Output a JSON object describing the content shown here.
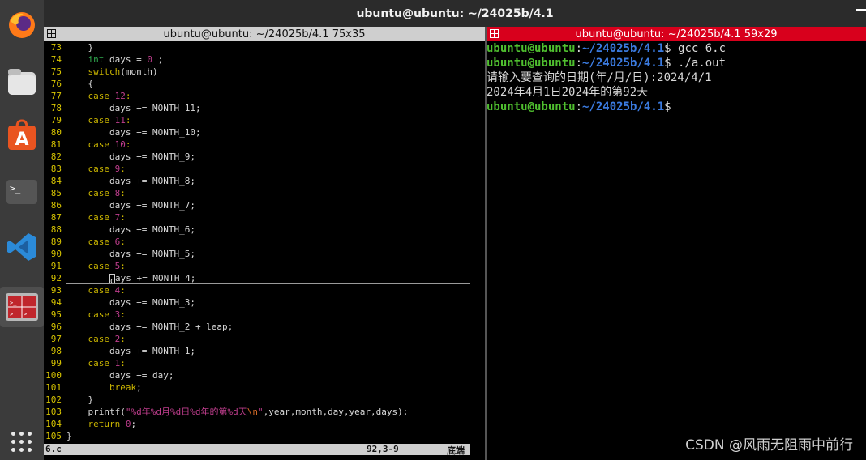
{
  "window": {
    "title": "ubuntu@ubuntu: ~/24025b/4.1"
  },
  "panes": {
    "left_title": "ubuntu@ubuntu: ~/24025b/4.1 75x35",
    "right_title": "ubuntu@ubuntu: ~/24025b/4.1 59x29"
  },
  "dock": {
    "items": [
      "firefox-icon",
      "files-icon",
      "software-icon",
      "terminal-icon",
      "vscode-icon",
      "terminal-split-icon",
      "show-apps-icon"
    ]
  },
  "editor": {
    "lines": [
      {
        "n": "73",
        "parts": [
          {
            "t": "    }",
            "c": "tx"
          }
        ]
      },
      {
        "n": "74",
        "parts": [
          {
            "t": "    ",
            "c": "tx"
          },
          {
            "t": "int",
            "c": "ty"
          },
          {
            "t": " days = ",
            "c": "tx"
          },
          {
            "t": "0",
            "c": "st"
          },
          {
            "t": " ;",
            "c": "tx"
          }
        ]
      },
      {
        "n": "75",
        "parts": [
          {
            "t": "    ",
            "c": "tx"
          },
          {
            "t": "switch",
            "c": "kw"
          },
          {
            "t": "(month)",
            "c": "tx"
          }
        ]
      },
      {
        "n": "76",
        "parts": [
          {
            "t": "    {",
            "c": "tx"
          }
        ]
      },
      {
        "n": "77",
        "parts": [
          {
            "t": "    ",
            "c": "tx"
          },
          {
            "t": "case",
            "c": "kw"
          },
          {
            "t": " ",
            "c": "tx"
          },
          {
            "t": "12",
            "c": "st"
          },
          {
            "t": ":",
            "c": "kw"
          }
        ]
      },
      {
        "n": "78",
        "parts": [
          {
            "t": "        days += MONTH_11;",
            "c": "tx"
          }
        ]
      },
      {
        "n": "79",
        "parts": [
          {
            "t": "    ",
            "c": "tx"
          },
          {
            "t": "case",
            "c": "kw"
          },
          {
            "t": " ",
            "c": "tx"
          },
          {
            "t": "11",
            "c": "st"
          },
          {
            "t": ":",
            "c": "kw"
          }
        ]
      },
      {
        "n": "80",
        "parts": [
          {
            "t": "        days += MONTH_10;",
            "c": "tx"
          }
        ]
      },
      {
        "n": "81",
        "parts": [
          {
            "t": "    ",
            "c": "tx"
          },
          {
            "t": "case",
            "c": "kw"
          },
          {
            "t": " ",
            "c": "tx"
          },
          {
            "t": "10",
            "c": "st"
          },
          {
            "t": ":",
            "c": "kw"
          }
        ]
      },
      {
        "n": "82",
        "parts": [
          {
            "t": "        days += MONTH_9;",
            "c": "tx"
          }
        ]
      },
      {
        "n": "83",
        "parts": [
          {
            "t": "    ",
            "c": "tx"
          },
          {
            "t": "case",
            "c": "kw"
          },
          {
            "t": " ",
            "c": "tx"
          },
          {
            "t": "9",
            "c": "st"
          },
          {
            "t": ":",
            "c": "kw"
          }
        ]
      },
      {
        "n": "84",
        "parts": [
          {
            "t": "        days += MONTH_8;",
            "c": "tx"
          }
        ]
      },
      {
        "n": "85",
        "parts": [
          {
            "t": "    ",
            "c": "tx"
          },
          {
            "t": "case",
            "c": "kw"
          },
          {
            "t": " ",
            "c": "tx"
          },
          {
            "t": "8",
            "c": "st"
          },
          {
            "t": ":",
            "c": "kw"
          }
        ]
      },
      {
        "n": "86",
        "parts": [
          {
            "t": "        days += MONTH_7;",
            "c": "tx"
          }
        ]
      },
      {
        "n": "87",
        "parts": [
          {
            "t": "    ",
            "c": "tx"
          },
          {
            "t": "case",
            "c": "kw"
          },
          {
            "t": " ",
            "c": "tx"
          },
          {
            "t": "7",
            "c": "st"
          },
          {
            "t": ":",
            "c": "kw"
          }
        ]
      },
      {
        "n": "88",
        "parts": [
          {
            "t": "        days += MONTH_6;",
            "c": "tx"
          }
        ]
      },
      {
        "n": "89",
        "parts": [
          {
            "t": "    ",
            "c": "tx"
          },
          {
            "t": "case",
            "c": "kw"
          },
          {
            "t": " ",
            "c": "tx"
          },
          {
            "t": "6",
            "c": "st"
          },
          {
            "t": ":",
            "c": "kw"
          }
        ]
      },
      {
        "n": "90",
        "parts": [
          {
            "t": "        days += MONTH_5;",
            "c": "tx"
          }
        ]
      },
      {
        "n": "91",
        "parts": [
          {
            "t": "    ",
            "c": "tx"
          },
          {
            "t": "case",
            "c": "kw"
          },
          {
            "t": " ",
            "c": "tx"
          },
          {
            "t": "5",
            "c": "st"
          },
          {
            "t": ":",
            "c": "kw"
          }
        ]
      },
      {
        "n": "92",
        "cursor": true,
        "pre": "        ",
        "cur": "d",
        "post": "ays += MONTH_4;"
      },
      {
        "n": "93",
        "parts": [
          {
            "t": "    ",
            "c": "tx"
          },
          {
            "t": "case",
            "c": "kw"
          },
          {
            "t": " ",
            "c": "tx"
          },
          {
            "t": "4",
            "c": "st"
          },
          {
            "t": ":",
            "c": "kw"
          }
        ]
      },
      {
        "n": "94",
        "parts": [
          {
            "t": "        days += MONTH_3;",
            "c": "tx"
          }
        ]
      },
      {
        "n": "95",
        "parts": [
          {
            "t": "    ",
            "c": "tx"
          },
          {
            "t": "case",
            "c": "kw"
          },
          {
            "t": " ",
            "c": "tx"
          },
          {
            "t": "3",
            "c": "st"
          },
          {
            "t": ":",
            "c": "kw"
          }
        ]
      },
      {
        "n": "96",
        "parts": [
          {
            "t": "        days += MONTH_2 + leap;",
            "c": "tx"
          }
        ]
      },
      {
        "n": "97",
        "parts": [
          {
            "t": "    ",
            "c": "tx"
          },
          {
            "t": "case",
            "c": "kw"
          },
          {
            "t": " ",
            "c": "tx"
          },
          {
            "t": "2",
            "c": "st"
          },
          {
            "t": ":",
            "c": "kw"
          }
        ]
      },
      {
        "n": "98",
        "parts": [
          {
            "t": "        days += MONTH_1;",
            "c": "tx"
          }
        ]
      },
      {
        "n": "99",
        "parts": [
          {
            "t": "    ",
            "c": "tx"
          },
          {
            "t": "case",
            "c": "kw"
          },
          {
            "t": " ",
            "c": "tx"
          },
          {
            "t": "1",
            "c": "st"
          },
          {
            "t": ":",
            "c": "kw"
          }
        ]
      },
      {
        "n": "100",
        "parts": [
          {
            "t": "        days += day;",
            "c": "tx"
          }
        ]
      },
      {
        "n": "101",
        "parts": [
          {
            "t": "        ",
            "c": "tx"
          },
          {
            "t": "break",
            "c": "kw"
          },
          {
            "t": ";",
            "c": "tx"
          }
        ]
      },
      {
        "n": "102",
        "parts": [
          {
            "t": "    }",
            "c": "tx"
          }
        ]
      },
      {
        "n": "103",
        "parts": [
          {
            "t": "    printf(",
            "c": "tx"
          },
          {
            "t": "\"%d年%d月%d日%d年的第%d天",
            "c": "st"
          },
          {
            "t": "\\n",
            "c": "esc"
          },
          {
            "t": "\"",
            "c": "st"
          },
          {
            "t": ",year,month,day,year,days);",
            "c": "tx"
          }
        ]
      },
      {
        "n": "104",
        "parts": [
          {
            "t": "    ",
            "c": "tx"
          },
          {
            "t": "return",
            "c": "kw"
          },
          {
            "t": " ",
            "c": "tx"
          },
          {
            "t": "0",
            "c": "st"
          },
          {
            "t": ";",
            "c": "tx"
          }
        ]
      },
      {
        "n": "105",
        "parts": [
          {
            "t": "}",
            "c": "tx"
          }
        ]
      }
    ],
    "status": {
      "file": "6.c",
      "position": "92,3-9",
      "scroll": "底端"
    }
  },
  "terminal": {
    "lines": [
      {
        "user": "ubuntu@ubuntu",
        "path": "~/24025b/4.1",
        "cmd": " gcc 6.c"
      },
      {
        "user": "ubuntu@ubuntu",
        "path": "~/24025b/4.1",
        "cmd": " ./a.out"
      },
      {
        "out": "请输入要查询的日期(年/月/日):2024/4/1"
      },
      {
        "out": "2024年4月1日2024年的第92天"
      },
      {
        "user": "ubuntu@ubuntu",
        "path": "~/24025b/4.1",
        "cmd": ""
      }
    ]
  },
  "watermark": "CSDN @风雨无阻雨中前行"
}
